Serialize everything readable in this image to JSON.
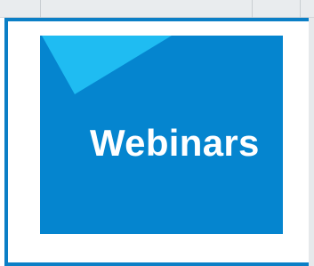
{
  "banner": {
    "title": "Webinars"
  },
  "colors": {
    "banner_bg": "#0585cf",
    "accent_triangle": "#1fbcf2",
    "frame": "#0b7fc6",
    "toolbar": "#e9ecee"
  }
}
